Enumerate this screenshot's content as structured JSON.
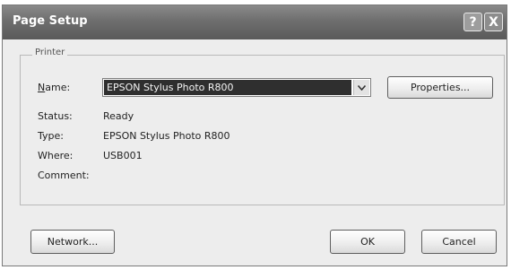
{
  "window": {
    "title": "Page Setup",
    "help_label": "?",
    "close_label": "X"
  },
  "printer_group": {
    "legend": "Printer",
    "name_label": "Name:",
    "name_value": "EPSON Stylus Photo R800",
    "properties_label": "Properties...",
    "status_label": "Status:",
    "status_value": "Ready",
    "type_label": "Type:",
    "type_value": "EPSON Stylus Photo R800",
    "where_label": "Where:",
    "where_value": "USB001",
    "comment_label": "Comment:",
    "comment_value": ""
  },
  "buttons": {
    "network_label": "Network...",
    "ok_label": "OK",
    "cancel_label": "Cancel"
  }
}
